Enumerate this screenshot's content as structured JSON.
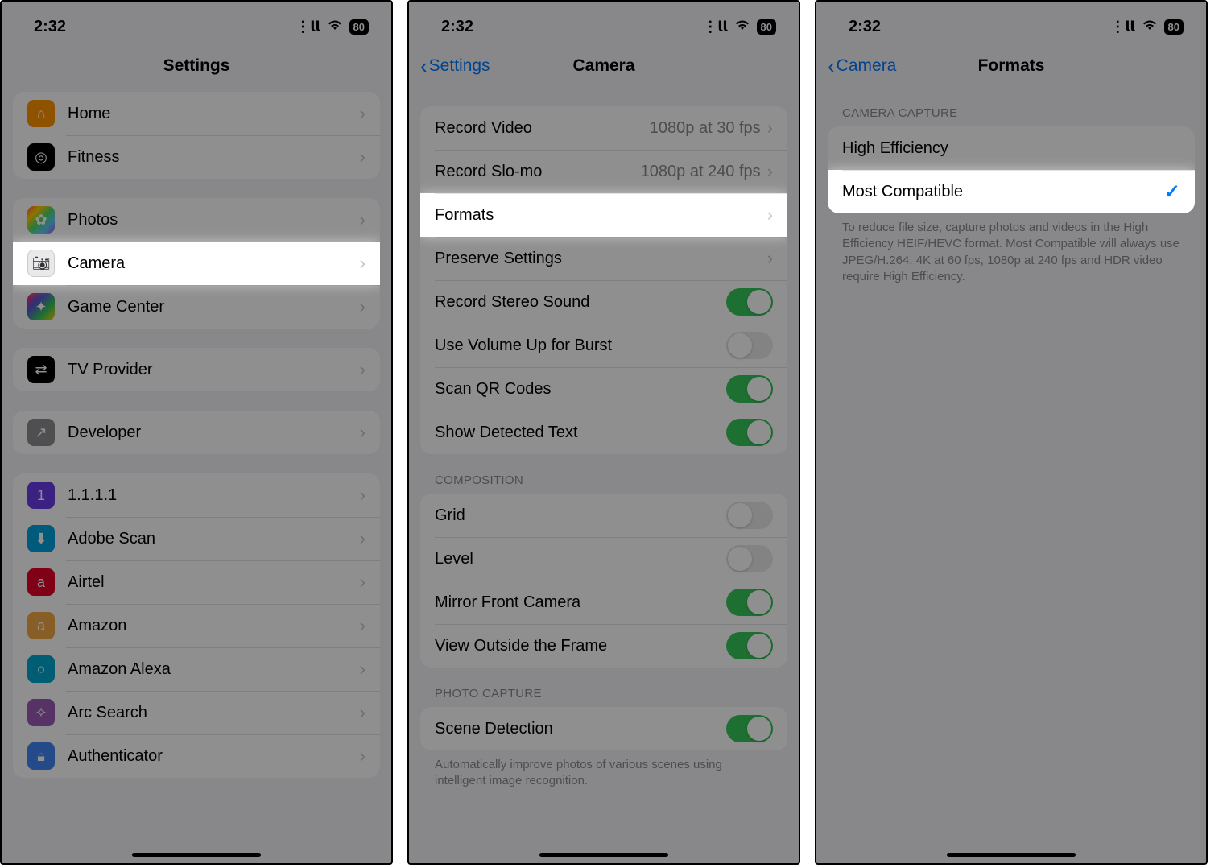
{
  "status": {
    "time": "2:32",
    "battery": "80"
  },
  "panel1": {
    "title": "Settings",
    "group1": [
      {
        "label": "Home",
        "icon": "home-icon"
      },
      {
        "label": "Fitness",
        "icon": "fitness-icon"
      }
    ],
    "group2": [
      {
        "label": "Photos",
        "icon": "photos-icon"
      },
      {
        "label": "Camera",
        "icon": "camera-icon",
        "highlight": true
      },
      {
        "label": "Game Center",
        "icon": "gamecenter-icon"
      }
    ],
    "group3": [
      {
        "label": "TV Provider",
        "icon": "tv-icon"
      }
    ],
    "group4": [
      {
        "label": "Developer",
        "icon": "developer-icon"
      }
    ],
    "group5": [
      {
        "label": "1.1.1.1",
        "icon": "1111-icon"
      },
      {
        "label": "Adobe Scan",
        "icon": "adobe-icon"
      },
      {
        "label": "Airtel",
        "icon": "airtel-icon"
      },
      {
        "label": "Amazon",
        "icon": "amazon-icon"
      },
      {
        "label": "Amazon Alexa",
        "icon": "alexa-icon"
      },
      {
        "label": "Arc Search",
        "icon": "arc-icon"
      },
      {
        "label": "Authenticator",
        "icon": "authenticator-icon"
      }
    ]
  },
  "panel2": {
    "back": "Settings",
    "title": "Camera",
    "rows": {
      "record_video": {
        "label": "Record Video",
        "detail": "1080p at 30 fps"
      },
      "record_slomo": {
        "label": "Record Slo-mo",
        "detail": "1080p at 240 fps"
      },
      "formats": {
        "label": "Formats"
      },
      "preserve": {
        "label": "Preserve Settings"
      },
      "stereo": {
        "label": "Record Stereo Sound",
        "on": true
      },
      "volume_burst": {
        "label": "Use Volume Up for Burst",
        "on": false
      },
      "qr": {
        "label": "Scan QR Codes",
        "on": true
      },
      "detected_text": {
        "label": "Show Detected Text",
        "on": true
      }
    },
    "composition_header": "COMPOSITION",
    "composition": {
      "grid": {
        "label": "Grid",
        "on": false
      },
      "level": {
        "label": "Level",
        "on": false
      },
      "mirror": {
        "label": "Mirror Front Camera",
        "on": true
      },
      "outside": {
        "label": "View Outside the Frame",
        "on": true
      }
    },
    "photo_header": "PHOTO CAPTURE",
    "photo": {
      "scene": {
        "label": "Scene Detection",
        "on": true
      }
    },
    "photo_footer": "Automatically improve photos of various scenes using intelligent image recognition."
  },
  "panel3": {
    "back": "Camera",
    "title": "Formats",
    "header": "CAMERA CAPTURE",
    "options": {
      "high_eff": {
        "label": "High Efficiency",
        "selected": false
      },
      "most_compat": {
        "label": "Most Compatible",
        "selected": true
      }
    },
    "footer": "To reduce file size, capture photos and videos in the High Efficiency HEIF/HEVC format. Most Compatible will always use JPEG/H.264. 4K at 60 fps, 1080p at 240 fps and HDR video require High Efficiency."
  }
}
